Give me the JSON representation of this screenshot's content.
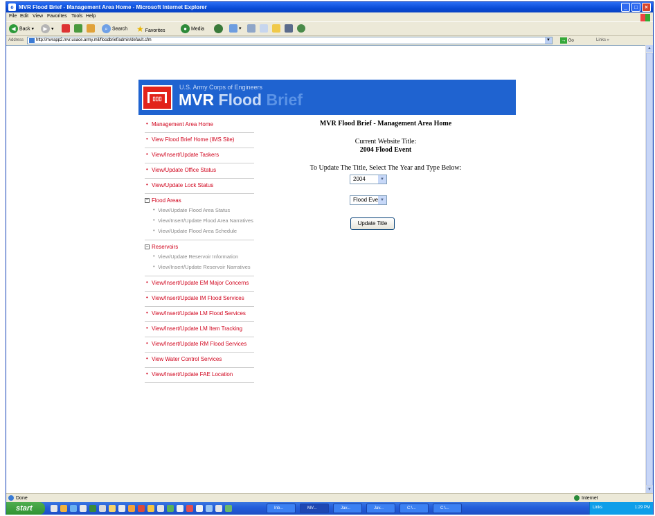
{
  "window": {
    "title": "MVR Flood Brief - Management Area Home - Microsoft Internet Explorer",
    "menu": [
      "File",
      "Edit",
      "View",
      "Favorites",
      "Tools",
      "Help"
    ],
    "toolbar": {
      "back": "Back",
      "search": "Search",
      "favorites": "Favorites",
      "media": "Media"
    },
    "address_label": "Address",
    "url": "http://mvrapp2.mvr.usace.army.mil/floodbrief/admin/default.cfm",
    "go_label": "Go",
    "links_label": "Links"
  },
  "banner": {
    "org": "U.S. Army Corps of Engineers",
    "logo_text": "MVR",
    "flood_text": "Flood",
    "brief_text": "Brief"
  },
  "nav": {
    "items_top": [
      "Management Area Home",
      "View Flood Brief Home (IMS Site)",
      "View/Insert/Update Taskers",
      "View/Update Office Status",
      "View/Update Lock Status"
    ],
    "flood_areas": {
      "label": "Flood Areas",
      "items": [
        "View/Update Flood Area Status",
        "View/Insert/Update Flood Area Narratives",
        "View/Update Flood Area Schedule"
      ]
    },
    "reservoirs": {
      "label": "Reservoirs",
      "items": [
        "View/Update Reservoir Information",
        "View/Insert/Update Reservoir Narratives"
      ]
    },
    "items_bottom": [
      "View/Insert/Update EM Major Concerns",
      "View/Insert/Update IM Flood Services",
      "View/Insert/Update LM Flood Services",
      "View/Insert/Update LM Item Tracking",
      "View/Insert/Update RM Flood Services",
      "View Water Control Services",
      "View/Insert/Update FAE Location"
    ]
  },
  "main": {
    "page_title": "MVR Flood Brief - Management Area Home",
    "current_label": "Current Website Title:",
    "current_value": "2004 Flood Event",
    "update_label": "To Update The Title, Select The Year and Type Below:",
    "year_select": "2004",
    "type_select": "Flood Event",
    "update_button": "Update Title"
  },
  "status": {
    "left": "Done",
    "zone": "Internet"
  },
  "taskbar": {
    "start": "start",
    "tasks": [
      "Inb...",
      "MV...",
      "Jav...",
      "Jav...",
      "C:\\...",
      "C:\\..."
    ],
    "tray_links": "Links",
    "clock": "1:29 PM"
  },
  "colors": {
    "banner_blue": "#1f63d0",
    "nav_red": "#d0021b",
    "castle_red": "#e2231a"
  }
}
